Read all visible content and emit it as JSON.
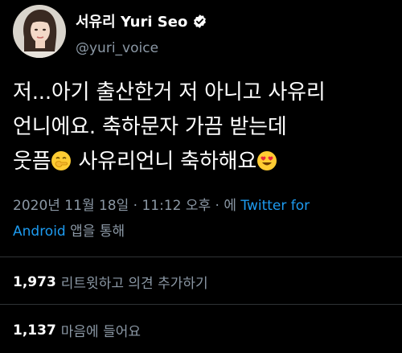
{
  "author": {
    "display_name": "서유리 Yuri Seo",
    "handle": "@yuri_voice"
  },
  "tweet": {
    "line1": "저...아기 출산한거 저 아니고 사유리",
    "line2": "언니에요. 축하문자 가끔 받는데",
    "line3_a": "웃픔",
    "line3_b": " 사유리언니 축하해요"
  },
  "meta": {
    "datetime": "2020년 11월 18일 · 11:12 오후 · 에 ",
    "source_a": "Twitter for",
    "source_b": "Android",
    "suffix": " 앱을 통해"
  },
  "stats": {
    "retweets_count": "1,973",
    "retweets_label": "리트윗하고 의견 추가하기",
    "likes_count": "1,137",
    "likes_label": "마음에 들어요"
  },
  "colors": {
    "background": "#000000",
    "text": "#ffffff",
    "muted": "#8b98a5",
    "link": "#1d9bf0",
    "divider": "#2f3336"
  },
  "icons": {
    "verified": "verified-badge-icon",
    "emoji1": "hand-over-mouth-emoji-icon",
    "emoji2": "heart-eyes-emoji-icon"
  }
}
